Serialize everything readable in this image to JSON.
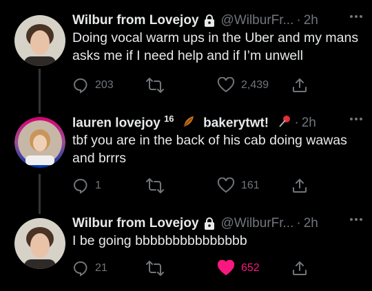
{
  "tweets": [
    {
      "name": "Wilbur from Lovejoy",
      "handle": "@WilburFr...",
      "time": "2h",
      "text": "Doing vocal warm ups in the Uber and my mans asks me if I need help and if I’m unwell",
      "replies": "203",
      "retweets": "",
      "likes": "2,439",
      "liked": false
    },
    {
      "name_prefix": "lauren lovejoy",
      "name_superscript": "16",
      "name_middle": "bakerytwt!",
      "time": "2h",
      "text": "tbf you are in the back of his cab doing wawas and brrrs",
      "replies": "1",
      "retweets": "",
      "likes": "161",
      "liked": false
    },
    {
      "name": "Wilbur from Lovejoy",
      "handle": "@WilburFr...",
      "time": "2h",
      "text": "I be going bbbbbbbbbbbbbbb",
      "replies": "21",
      "retweets": "",
      "likes": "652",
      "liked": true
    }
  ],
  "separator": "·",
  "icons": {
    "verified": "lock-badge-icon",
    "emoji_leaf": "autumn-leaves-emoji",
    "emoji_pin": "pushpin-emoji",
    "reply": "reply-icon",
    "retweet": "retweet-icon",
    "like": "heart-icon",
    "share": "share-icon",
    "more": "more-icon"
  },
  "colors": {
    "background": "#000000",
    "text": "#e7e9ea",
    "muted": "#71767b",
    "like_active": "#f91880",
    "thread_line": "#333639"
  }
}
